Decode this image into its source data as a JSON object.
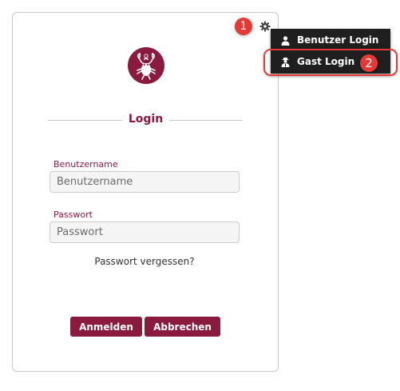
{
  "login": {
    "heading": "Login",
    "username_label": "Benutzername",
    "username_placeholder": "Benutzername",
    "password_label": "Passwort",
    "password_placeholder": "Passwort",
    "forgot_password": "Passwort vergessen?",
    "submit_label": "Anmelden",
    "cancel_label": "Abbrechen"
  },
  "dropdown": {
    "items": [
      {
        "label": "Benutzer Login",
        "icon": "user-icon"
      },
      {
        "label": "Gast Login",
        "icon": "guest-user-icon"
      }
    ]
  },
  "annotations": {
    "step1": "1",
    "step2": "2"
  },
  "colors": {
    "brand": "#8b1a3f",
    "dropdown_bg": "#1f1f1f",
    "annotation": "#e53935"
  },
  "icons": {
    "settings": "gear-icon",
    "logo": "lobster-logo-icon"
  }
}
